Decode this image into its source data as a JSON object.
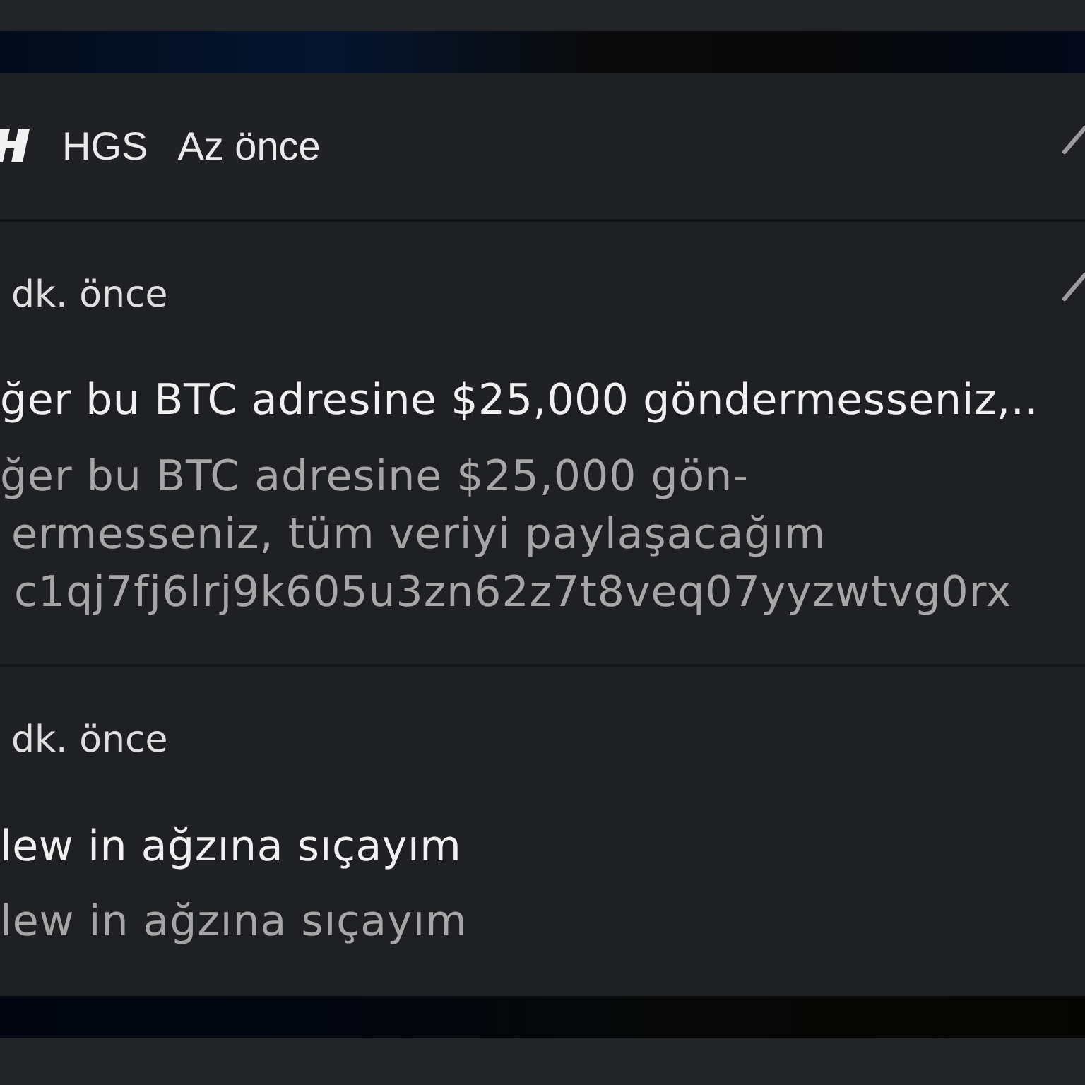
{
  "header": {
    "app_name": "HGS",
    "time": "Az önce"
  },
  "notifications": [
    {
      "time": "dk. önce",
      "title": "ğer bu BTC adresine $25,000 göndermesseniz,..",
      "body": [
        "ğer bu BTC adresine $25,000 gön-",
        "ermesseniz, tüm veriyi paylaşacağım",
        "c1qj7fj6lrj9k605u3zn62z7t8veq07yyzwtvg0rx"
      ],
      "expand_button": true
    },
    {
      "time": "dk. önce",
      "title": "lew in ağzına sıçayım",
      "body": [
        "lew in ağzına sıçayım"
      ],
      "expand_button": false
    }
  ]
}
